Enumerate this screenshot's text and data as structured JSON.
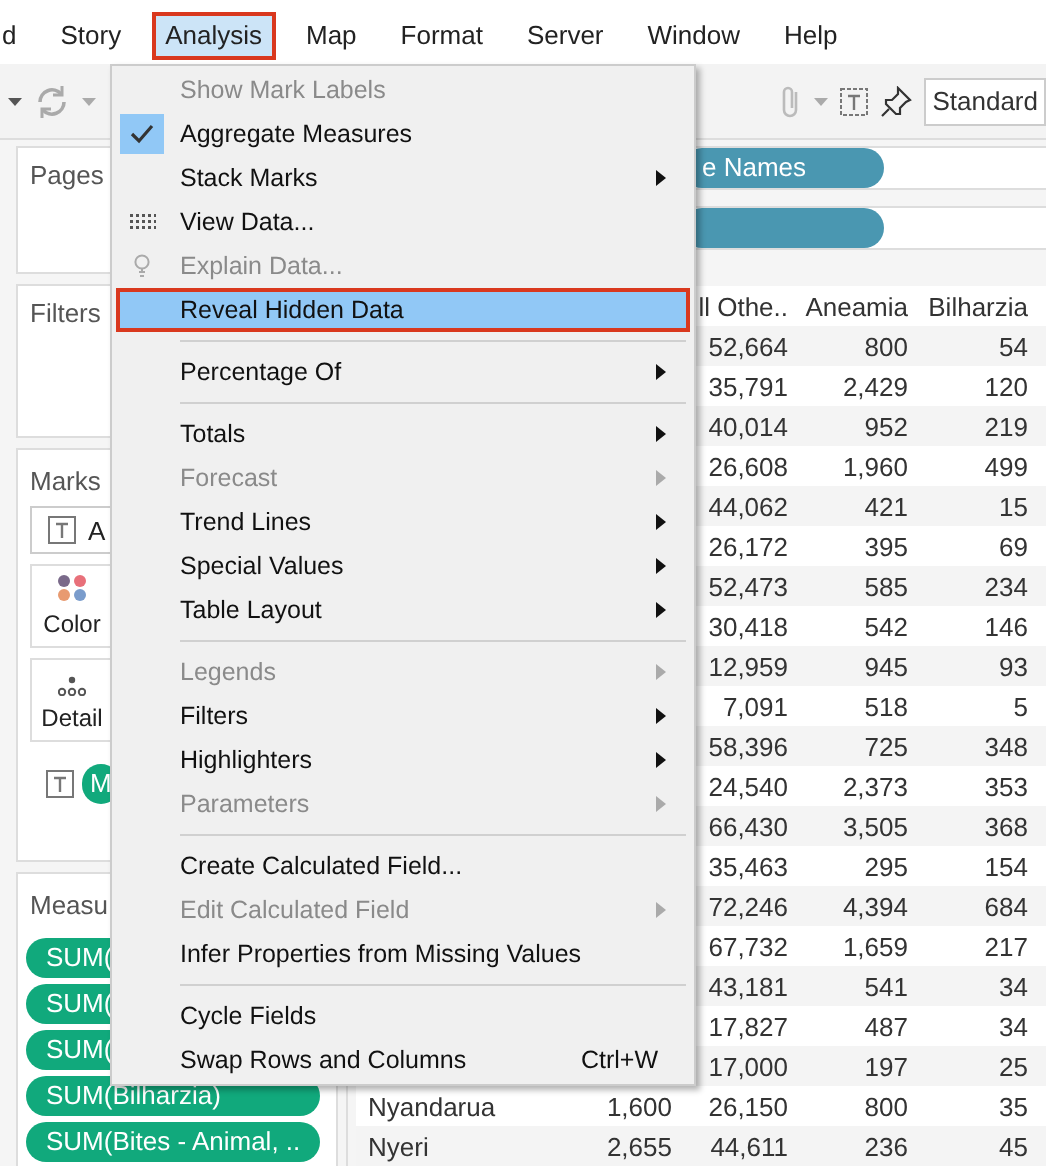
{
  "menubar": [
    {
      "label": "d",
      "selected": false
    },
    {
      "label": "Story",
      "selected": false
    },
    {
      "label": "Analysis",
      "selected": true
    },
    {
      "label": "Map",
      "selected": false
    },
    {
      "label": "Format",
      "selected": false
    },
    {
      "label": "Server",
      "selected": false
    },
    {
      "label": "Window",
      "selected": false
    },
    {
      "label": "Help",
      "selected": false
    }
  ],
  "toolbar": {
    "view_size": "Standard"
  },
  "left_panel": {
    "pages": {
      "title": "Pages"
    },
    "filters": {
      "title": "Filters"
    },
    "marks": {
      "title": "Marks",
      "mark_type": "A",
      "buttons": [
        {
          "label": "Color",
          "kind": "color"
        },
        {
          "label": "Detail",
          "kind": "detail"
        }
      ],
      "text_pill": "M"
    },
    "measure_values": {
      "title": "Measu",
      "pills": [
        "SUM(",
        "SUM(",
        "SUM(",
        "SUM(Bilharzia)",
        "SUM(Bites - Animal, .."
      ]
    }
  },
  "shelves": [
    {
      "kind": "pill",
      "label": "e Names"
    },
    {
      "kind": "pill"
    }
  ],
  "table": {
    "columns": [
      "ll Othe..",
      "Aneamia",
      "Bilharzia"
    ],
    "rows": [
      {
        "values": [
          "52,664",
          "800",
          "54"
        ]
      },
      {
        "values": [
          "35,791",
          "2,429",
          "120"
        ]
      },
      {
        "values": [
          "40,014",
          "952",
          "219"
        ]
      },
      {
        "values": [
          "26,608",
          "1,960",
          "499"
        ]
      },
      {
        "values": [
          "44,062",
          "421",
          "15"
        ]
      },
      {
        "values": [
          "26,172",
          "395",
          "69"
        ]
      },
      {
        "values": [
          "52,473",
          "585",
          "234"
        ]
      },
      {
        "values": [
          "30,418",
          "542",
          "146"
        ]
      },
      {
        "values": [
          "12,959",
          "945",
          "93"
        ]
      },
      {
        "values": [
          "7,091",
          "518",
          "5"
        ]
      },
      {
        "values": [
          "58,396",
          "725",
          "348"
        ]
      },
      {
        "values": [
          "24,540",
          "2,373",
          "353"
        ]
      },
      {
        "values": [
          "66,430",
          "3,505",
          "368"
        ]
      },
      {
        "values": [
          "35,463",
          "295",
          "154"
        ]
      },
      {
        "values": [
          "72,246",
          "4,394",
          "684"
        ]
      },
      {
        "values": [
          "67,732",
          "1,659",
          "217"
        ]
      },
      {
        "values": [
          "43,181",
          "541",
          "34"
        ]
      },
      {
        "values": [
          "17,827",
          "487",
          "34"
        ]
      },
      {
        "values": [
          "17,000",
          "197",
          "25"
        ]
      },
      {
        "name": "Nyandarua",
        "column_2": "1,600",
        "values": [
          "26,150",
          "800",
          "35"
        ]
      },
      {
        "name": "Nyeri",
        "column_2": "2,655",
        "values": [
          "44,611",
          "236",
          "45"
        ]
      }
    ]
  },
  "menu": {
    "items": [
      {
        "kind": "plain",
        "label": "Show Mark Labels",
        "disabled": true,
        "checked": false,
        "submenu": false,
        "selected": false
      },
      {
        "kind": "plain",
        "label": "Aggregate Measures",
        "disabled": false,
        "checked": true,
        "submenu": false,
        "selected": false
      },
      {
        "kind": "plain",
        "label": "Stack Marks",
        "disabled": false,
        "checked": false,
        "submenu": true,
        "selected": false
      },
      {
        "kind": "grid",
        "label": "View Data...",
        "disabled": false,
        "checked": false,
        "submenu": false,
        "selected": false
      },
      {
        "kind": "bulb",
        "label": "Explain Data...",
        "disabled": true,
        "checked": false,
        "submenu": false,
        "selected": false
      },
      {
        "kind": "plain",
        "label": "Reveal Hidden Data",
        "disabled": false,
        "checked": false,
        "submenu": false,
        "selected": true
      },
      {
        "kind": "separator"
      },
      {
        "kind": "plain",
        "label": "Percentage Of",
        "disabled": false,
        "checked": false,
        "submenu": true,
        "selected": false
      },
      {
        "kind": "separator"
      },
      {
        "kind": "plain",
        "label": "Totals",
        "disabled": false,
        "checked": false,
        "submenu": true,
        "selected": false
      },
      {
        "kind": "plain",
        "label": "Forecast",
        "disabled": true,
        "checked": false,
        "submenu": true,
        "selected": false
      },
      {
        "kind": "plain",
        "label": "Trend Lines",
        "disabled": false,
        "checked": false,
        "submenu": true,
        "selected": false
      },
      {
        "kind": "plain",
        "label": "Special Values",
        "disabled": false,
        "checked": false,
        "submenu": true,
        "selected": false
      },
      {
        "kind": "plain",
        "label": "Table Layout",
        "disabled": false,
        "checked": false,
        "submenu": true,
        "selected": false
      },
      {
        "kind": "separator"
      },
      {
        "kind": "plain",
        "label": "Legends",
        "disabled": true,
        "checked": false,
        "submenu": true,
        "selected": false
      },
      {
        "kind": "plain",
        "label": "Filters",
        "disabled": false,
        "checked": false,
        "submenu": true,
        "selected": false
      },
      {
        "kind": "plain",
        "label": "Highlighters",
        "disabled": false,
        "checked": false,
        "submenu": true,
        "selected": false
      },
      {
        "kind": "plain",
        "label": "Parameters",
        "disabled": true,
        "checked": false,
        "submenu": true,
        "selected": false
      },
      {
        "kind": "separator"
      },
      {
        "kind": "plain",
        "label": "Create Calculated Field...",
        "disabled": false,
        "checked": false,
        "submenu": false,
        "selected": false
      },
      {
        "kind": "plain",
        "label": "Edit Calculated Field",
        "disabled": true,
        "checked": false,
        "submenu": true,
        "selected": false
      },
      {
        "kind": "plain",
        "label": "Infer Properties from Missing Values",
        "disabled": false,
        "checked": false,
        "submenu": false,
        "selected": false
      },
      {
        "kind": "separator"
      },
      {
        "kind": "plain",
        "label": "Cycle Fields",
        "disabled": false,
        "checked": false,
        "submenu": false,
        "selected": false
      },
      {
        "kind": "plain",
        "label": "Swap Rows and Columns",
        "disabled": false,
        "checked": false,
        "submenu": false,
        "selected": false,
        "shortcut": "Ctrl+W"
      }
    ]
  }
}
